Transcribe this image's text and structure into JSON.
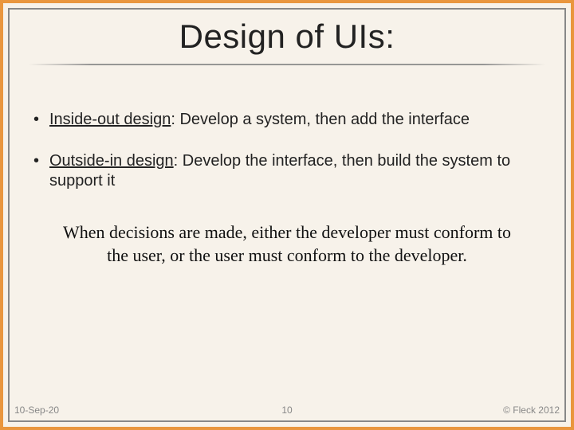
{
  "title": "Design of UIs:",
  "bullets": [
    {
      "term": "Inside-out design",
      "rest": ": Develop a system, then add the interface"
    },
    {
      "term": "Outside-in design",
      "rest": ": Develop the interface, then build the system to support it"
    }
  ],
  "statement": {
    "pre": "When decisions are made, either the developer must ",
    "k1": "conform",
    "mid": " to the user, or the user must ",
    "k2": "conform",
    "post": " to the developer."
  },
  "footer": {
    "date": "10-Sep-20",
    "page": "10",
    "copyright": "© Fleck 2012"
  },
  "colors": {
    "accent": "#e9963e",
    "background": "#f7f2ea",
    "frame": "#888888"
  }
}
